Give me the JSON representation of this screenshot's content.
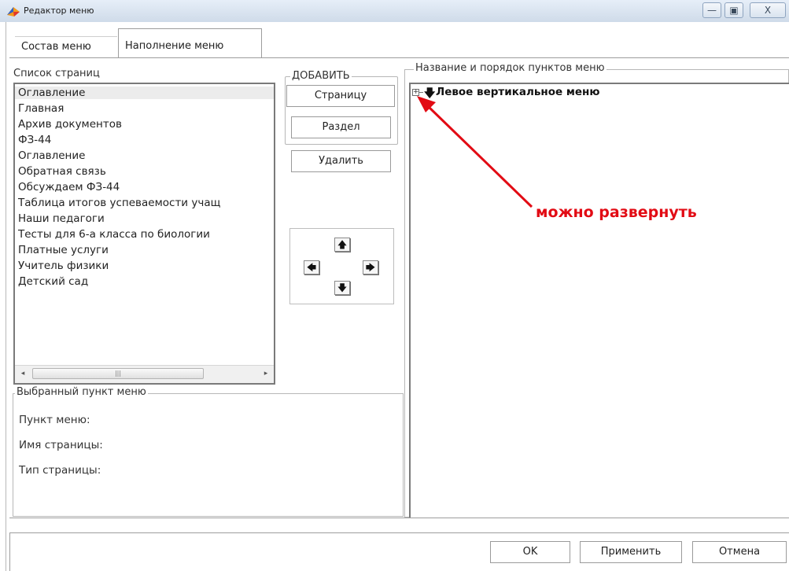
{
  "window": {
    "title": "Редактор меню",
    "minimize_glyph": "—",
    "maximize_glyph": "▣",
    "close_glyph": "X"
  },
  "tabs": [
    {
      "label": "Состав меню"
    },
    {
      "label": "Наполнение меню"
    }
  ],
  "pages": {
    "label": "Список страниц",
    "items": [
      "Оглавление",
      "Главная",
      "Архив документов",
      "ФЗ-44",
      "Оглавление",
      "Обратная связь",
      "Обсуждаем ФЗ-44",
      "Таблица итогов успеваемости учащ",
      "Наши педагоги",
      "Тесты для 6-а класса по биологии",
      "Платные услуги",
      "Учитель физики",
      "Детский сад"
    ],
    "scroll_left": "◂",
    "scroll_right": "▸",
    "scroll_grip": "|||"
  },
  "add": {
    "label": "ДОБАВИТЬ",
    "page_button": "Страницу",
    "section_button": "Раздел"
  },
  "delete_button": "Удалить",
  "move": {
    "up": "🡅",
    "down": "🡇",
    "left": "🡄",
    "right": "🡆"
  },
  "selected_item": {
    "label": "Выбранный пункт меню",
    "menu_item": "Пункт меню:",
    "page_name": "Имя страницы:",
    "page_type": "Тип страницы:"
  },
  "menu_tree": {
    "label": "Название и порядок пунктов меню",
    "expand_glyph": "+",
    "item_arrow": "🡇",
    "root_item": "Левое вертикальное меню"
  },
  "annotation": {
    "text": "можно развернуть",
    "color": "#e20b14"
  },
  "buttons": {
    "ok": "OK",
    "apply": "Применить",
    "cancel": "Отмена"
  }
}
